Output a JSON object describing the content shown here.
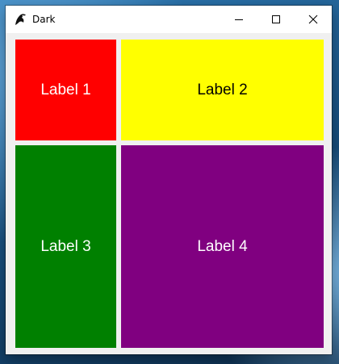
{
  "window": {
    "title": "Dark",
    "icon": "app-logo-icon",
    "controls": {
      "minimize_icon": "minimize-icon",
      "maximize_icon": "maximize-icon",
      "close_icon": "close-icon"
    }
  },
  "tiles": [
    {
      "label": "Label 1",
      "background": "#ff0000",
      "text_color": "#ffffff"
    },
    {
      "label": "Label 2",
      "background": "#ffff00",
      "text_color": "#000000"
    },
    {
      "label": "Label 3",
      "background": "#008000",
      "text_color": "#ffffff"
    },
    {
      "label": "Label 4",
      "background": "#800080",
      "text_color": "#ffffff"
    }
  ]
}
